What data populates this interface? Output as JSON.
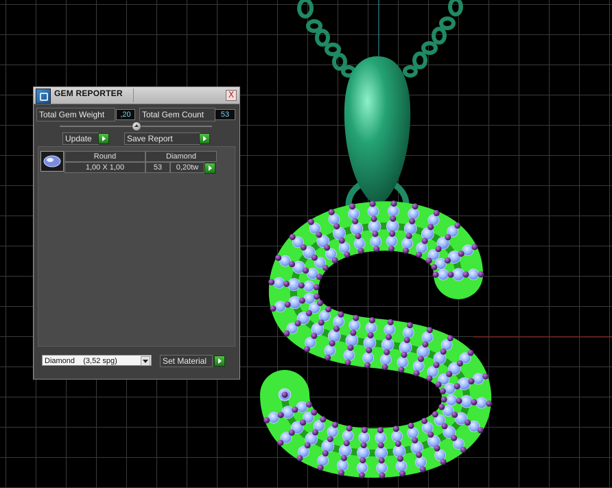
{
  "panel": {
    "title": "GEM REPORTER",
    "close_label": "X",
    "total_weight_label": "Total Gem Weight",
    "total_weight_value": ",20",
    "total_count_label": "Total Gem Count",
    "total_count_value": "53",
    "update_label": "Update",
    "save_report_label": "Save Report",
    "table": {
      "headers": [
        "Round",
        "Diamond"
      ],
      "rows": [
        {
          "size": "1,00 X 1,00",
          "count": "53",
          "weight": "0,20tw"
        }
      ]
    },
    "material_select": "Diamond    (3,52 spg)",
    "set_material_label": "Set Material"
  },
  "colors": {
    "viewport_bg": "#000000",
    "grid": "#3a3a3a",
    "metal": "#1f8a63",
    "setting": "#3fe83a",
    "gem": "#8fb4ff",
    "prong": "#6a1f8a",
    "axis_x": "#b01818",
    "axis_y": "#2aa7a7"
  }
}
